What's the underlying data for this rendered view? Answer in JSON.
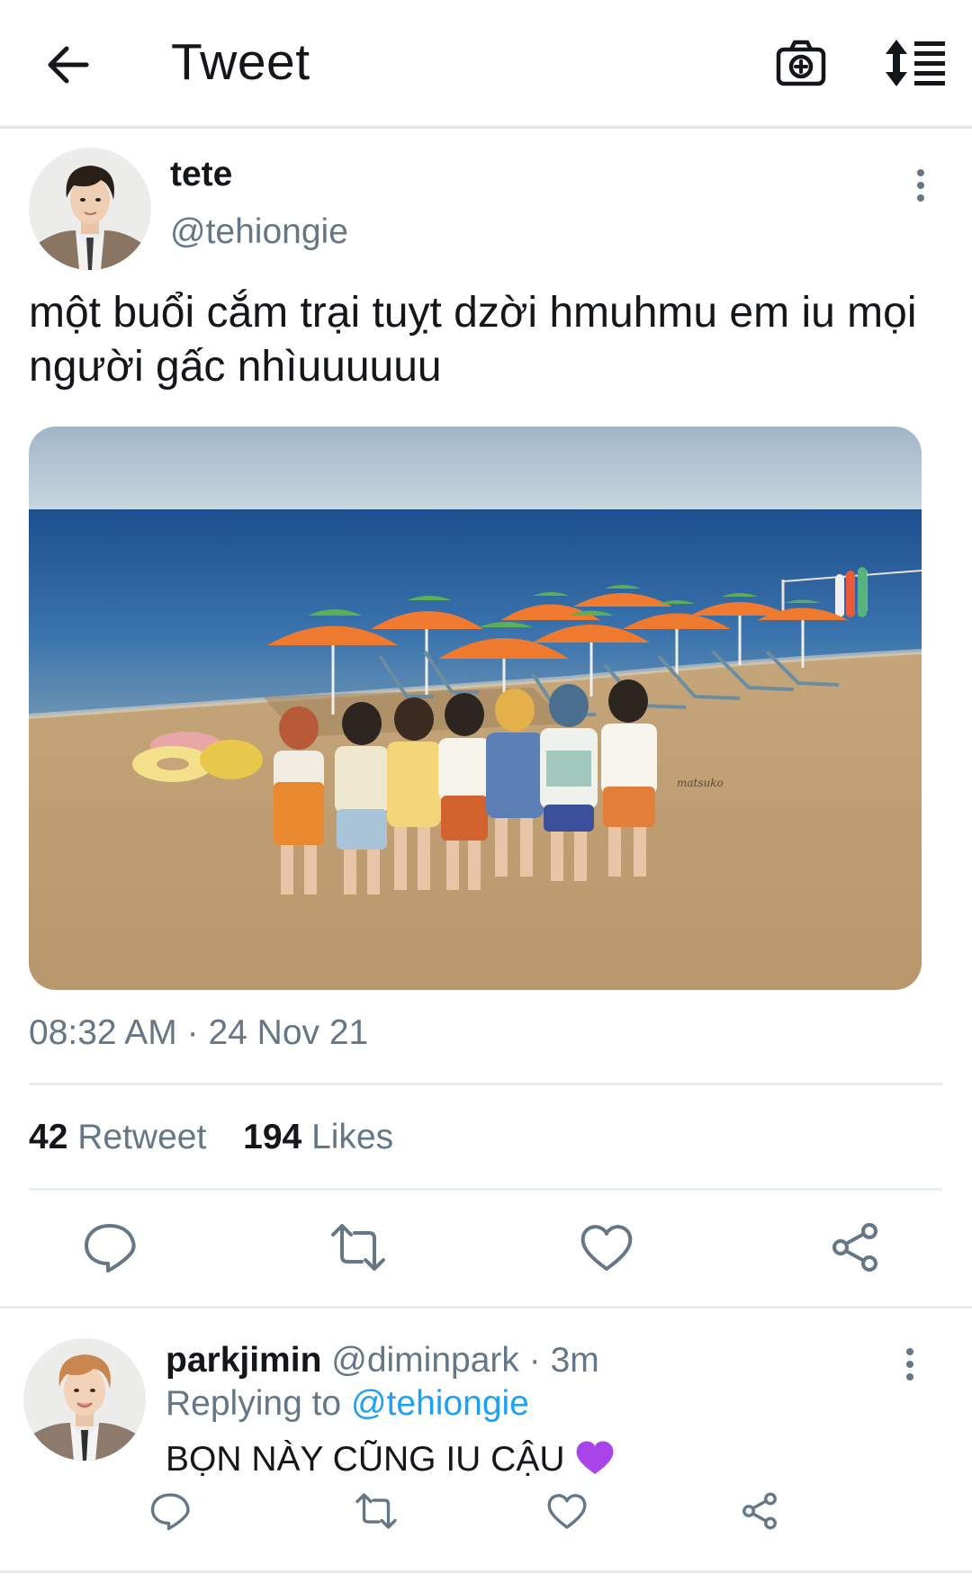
{
  "header": {
    "title": "Tweet",
    "back_icon": "arrow-left-icon",
    "camera_icon": "camera-plus-icon",
    "sort_icon": "sort-list-icon"
  },
  "tweet": {
    "display_name": "tete",
    "handle": "@tehiongie",
    "text": "một buổi cắm trại tuỵt dzời hmuhmu em iu mọi người gấc nhìuuuuuu",
    "time": "08:32 AM",
    "date": "24 Nov 21",
    "retweets": "42",
    "retweet_label": "Retweet",
    "likes": "194",
    "likes_label": "Likes",
    "media_icon": "beach-photo",
    "watermark": "matsuko"
  },
  "actions": {
    "reply_icon": "comment-icon",
    "retweet_icon": "retweet-icon",
    "like_icon": "heart-icon",
    "share_icon": "share-icon"
  },
  "reply": {
    "display_name": "parkjimin",
    "handle": "@diminpark",
    "time": "3m",
    "separator": "·",
    "replying_prefix": "Replying to",
    "replying_mention": "@tehiongie",
    "text": "BỌN NÀY CŨNG IU CẬU",
    "emoji": "💜"
  },
  "colors": {
    "text": "#14171a",
    "secondary": "#657786",
    "accent": "#1da1f2",
    "divider": "#e6ecf0"
  }
}
